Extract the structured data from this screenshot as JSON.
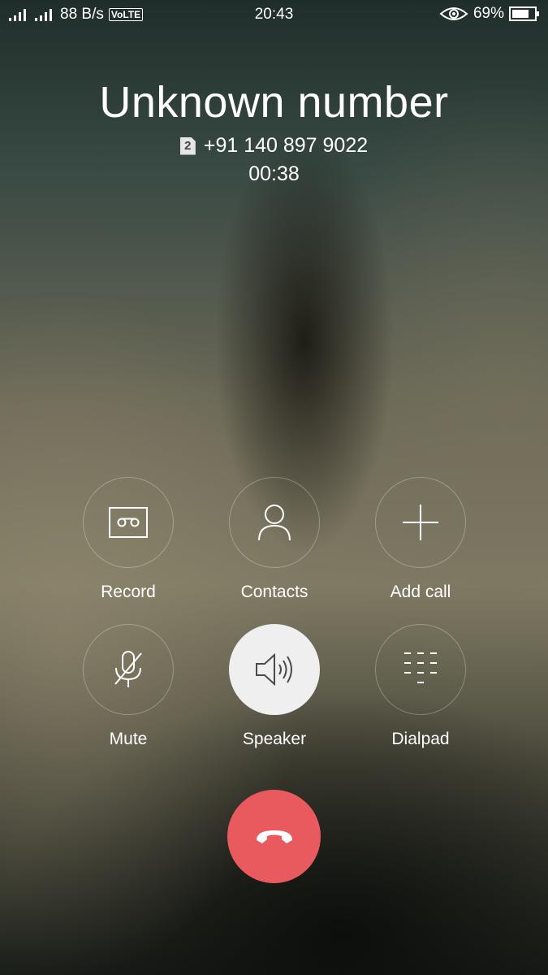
{
  "status_bar": {
    "data_speed": "88 B/s",
    "volte": "VoLTE",
    "time": "20:43",
    "battery": "69%"
  },
  "call": {
    "caller_name": "Unknown number",
    "sim_slot": "2",
    "phone_number": "+91 140 897 9022",
    "duration": "00:38"
  },
  "controls": {
    "record": "Record",
    "contacts": "Contacts",
    "add_call": "Add call",
    "mute": "Mute",
    "speaker": "Speaker",
    "dialpad": "Dialpad"
  },
  "icons": [
    "signal-icon",
    "eye-icon",
    "battery-icon",
    "record-icon",
    "contacts-icon",
    "add-call-icon",
    "mute-icon",
    "speaker-icon",
    "dialpad-icon",
    "end-call-icon"
  ],
  "colors": {
    "end_call": "#e85a5e",
    "speaker_active": "#efefef"
  }
}
